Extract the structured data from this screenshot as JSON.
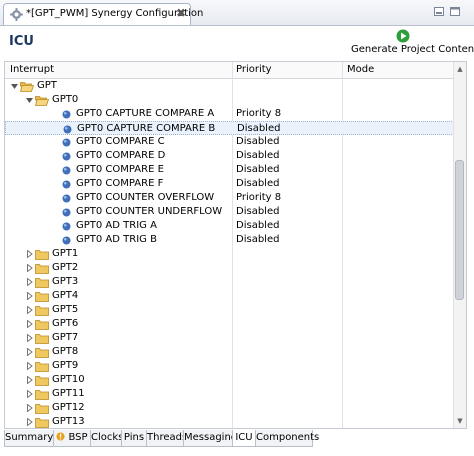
{
  "editor_tab": {
    "title": "*[GPT_PWM] Synergy Configuration",
    "close_glyph": "✖"
  },
  "header": {
    "title": "ICU",
    "generate_label": "Generate Project Content"
  },
  "table": {
    "columns": [
      "Interrupt",
      "Priority",
      "Mode"
    ],
    "rows": [
      {
        "label": "GPT",
        "priority": "",
        "type": "folder",
        "depth": 0,
        "expanded": true
      },
      {
        "label": "GPT0",
        "priority": "",
        "type": "folder",
        "depth": 1,
        "expanded": true
      },
      {
        "label": "GPT0 CAPTURE COMPARE A",
        "priority": "Priority 8",
        "type": "leaf",
        "depth": 2
      },
      {
        "label": "GPT0 CAPTURE COMPARE B",
        "priority": "Disabled",
        "type": "leaf",
        "depth": 2,
        "selected": true
      },
      {
        "label": "GPT0 COMPARE C",
        "priority": "Disabled",
        "type": "leaf",
        "depth": 2
      },
      {
        "label": "GPT0 COMPARE D",
        "priority": "Disabled",
        "type": "leaf",
        "depth": 2
      },
      {
        "label": "GPT0 COMPARE E",
        "priority": "Disabled",
        "type": "leaf",
        "depth": 2
      },
      {
        "label": "GPT0 COMPARE F",
        "priority": "Disabled",
        "type": "leaf",
        "depth": 2
      },
      {
        "label": "GPT0 COUNTER OVERFLOW",
        "priority": "Priority 8",
        "type": "leaf",
        "depth": 2
      },
      {
        "label": "GPT0 COUNTER UNDERFLOW",
        "priority": "Disabled",
        "type": "leaf",
        "depth": 2
      },
      {
        "label": "GPT0 AD TRIG A",
        "priority": "Disabled",
        "type": "leaf",
        "depth": 2
      },
      {
        "label": "GPT0 AD TRIG B",
        "priority": "Disabled",
        "type": "leaf",
        "depth": 2
      },
      {
        "label": "GPT1",
        "priority": "",
        "type": "folder",
        "depth": 1,
        "expanded": false
      },
      {
        "label": "GPT2",
        "priority": "",
        "type": "folder",
        "depth": 1,
        "expanded": false
      },
      {
        "label": "GPT3",
        "priority": "",
        "type": "folder",
        "depth": 1,
        "expanded": false
      },
      {
        "label": "GPT4",
        "priority": "",
        "type": "folder",
        "depth": 1,
        "expanded": false
      },
      {
        "label": "GPT5",
        "priority": "",
        "type": "folder",
        "depth": 1,
        "expanded": false
      },
      {
        "label": "GPT6",
        "priority": "",
        "type": "folder",
        "depth": 1,
        "expanded": false
      },
      {
        "label": "GPT7",
        "priority": "",
        "type": "folder",
        "depth": 1,
        "expanded": false
      },
      {
        "label": "GPT8",
        "priority": "",
        "type": "folder",
        "depth": 1,
        "expanded": false
      },
      {
        "label": "GPT9",
        "priority": "",
        "type": "folder",
        "depth": 1,
        "expanded": false
      },
      {
        "label": "GPT10",
        "priority": "",
        "type": "folder",
        "depth": 1,
        "expanded": false
      },
      {
        "label": "GPT11",
        "priority": "",
        "type": "folder",
        "depth": 1,
        "expanded": false
      },
      {
        "label": "GPT12",
        "priority": "",
        "type": "folder",
        "depth": 1,
        "expanded": false
      },
      {
        "label": "GPT13",
        "priority": "",
        "type": "folder",
        "depth": 1,
        "expanded": false
      }
    ]
  },
  "bottom_tabs": [
    {
      "label": "Summary",
      "active": false
    },
    {
      "label": "BSP",
      "active": false,
      "icon": "warning-icon"
    },
    {
      "label": "Clocks",
      "active": false
    },
    {
      "label": "Pins",
      "active": false
    },
    {
      "label": "Threads",
      "active": false
    },
    {
      "label": "Messaging",
      "active": false
    },
    {
      "label": "ICU",
      "active": true
    },
    {
      "label": "Components",
      "active": false
    }
  ],
  "colors": {
    "accent": "#1e3a64",
    "folder": "#e8b84a",
    "leaf": "#3f6fb8",
    "generate": "#2c9e3a",
    "selection": "#eaf2fb"
  }
}
